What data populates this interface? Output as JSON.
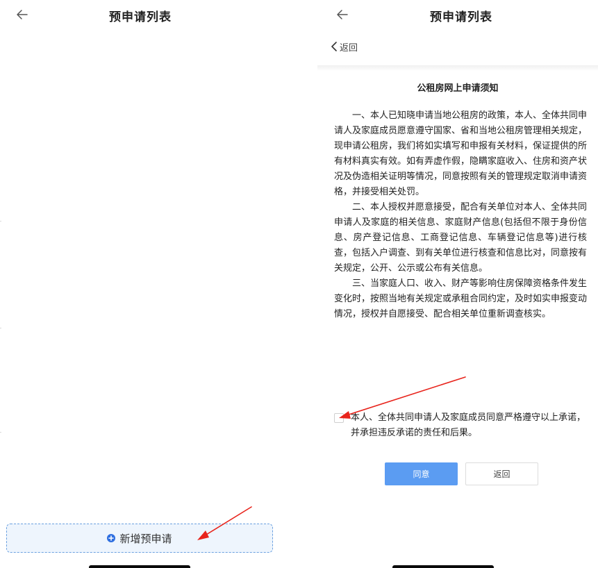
{
  "left_screen": {
    "title": "预申请列表",
    "add_button_label": "新增预申请",
    "icons": {
      "back": "arrow-left-icon",
      "add": "plus-circle-icon"
    }
  },
  "right_screen": {
    "title": "预申请列表",
    "sub_back_label": "返回",
    "notice_title": "公租房网上申请须知",
    "paragraphs": [
      "一、本人已知晓申请当地公租房的政策，本人、全体共同申请人及家庭成员愿意遵守国家、省和当地公租房管理相关规定，现申请公租房，我们将如实填写和申报有关材料，保证提供的所有材料真实有效。如有弄虚作假，隐瞒家庭收入、住房和资产状况及伪造相关证明等情况，同意按照有关的管理规定取消申请资格，并接受相关处罚。",
      "二、本人授权并愿意接受，配合有关单位对本人、全体共同申请人及家庭的相关信息、家庭财产信息(包括但不限于身份信息、房产登记信息、工商登记信息、车辆登记信息等)进行核查，包括入户调查、到有关单位进行核查和信息比对，同意按有关规定，公开、公示或公布有关信息。",
      "三、当家庭人口、收入、财产等影响住房保障资格条件发生变化时，按照当地有关规定或承租合同约定，及时如实申报变动情况，授权并自愿接受、配合相关单位重新调查核实。"
    ],
    "agree_text": "本人、全体共同申请人及家庭成员同意严格遵守以上承诺，并承担违反承诺的责任和后果。",
    "agree_checked": false,
    "agree_button": "同意",
    "return_button": "返回",
    "icons": {
      "back": "arrow-left-icon",
      "sub_back": "chevron-left-icon"
    }
  },
  "colors": {
    "primary": "#5b9cf2",
    "dashed_border": "#6aa0e0",
    "add_box_bg": "#eef5fd",
    "annotation": "#e8241c"
  }
}
